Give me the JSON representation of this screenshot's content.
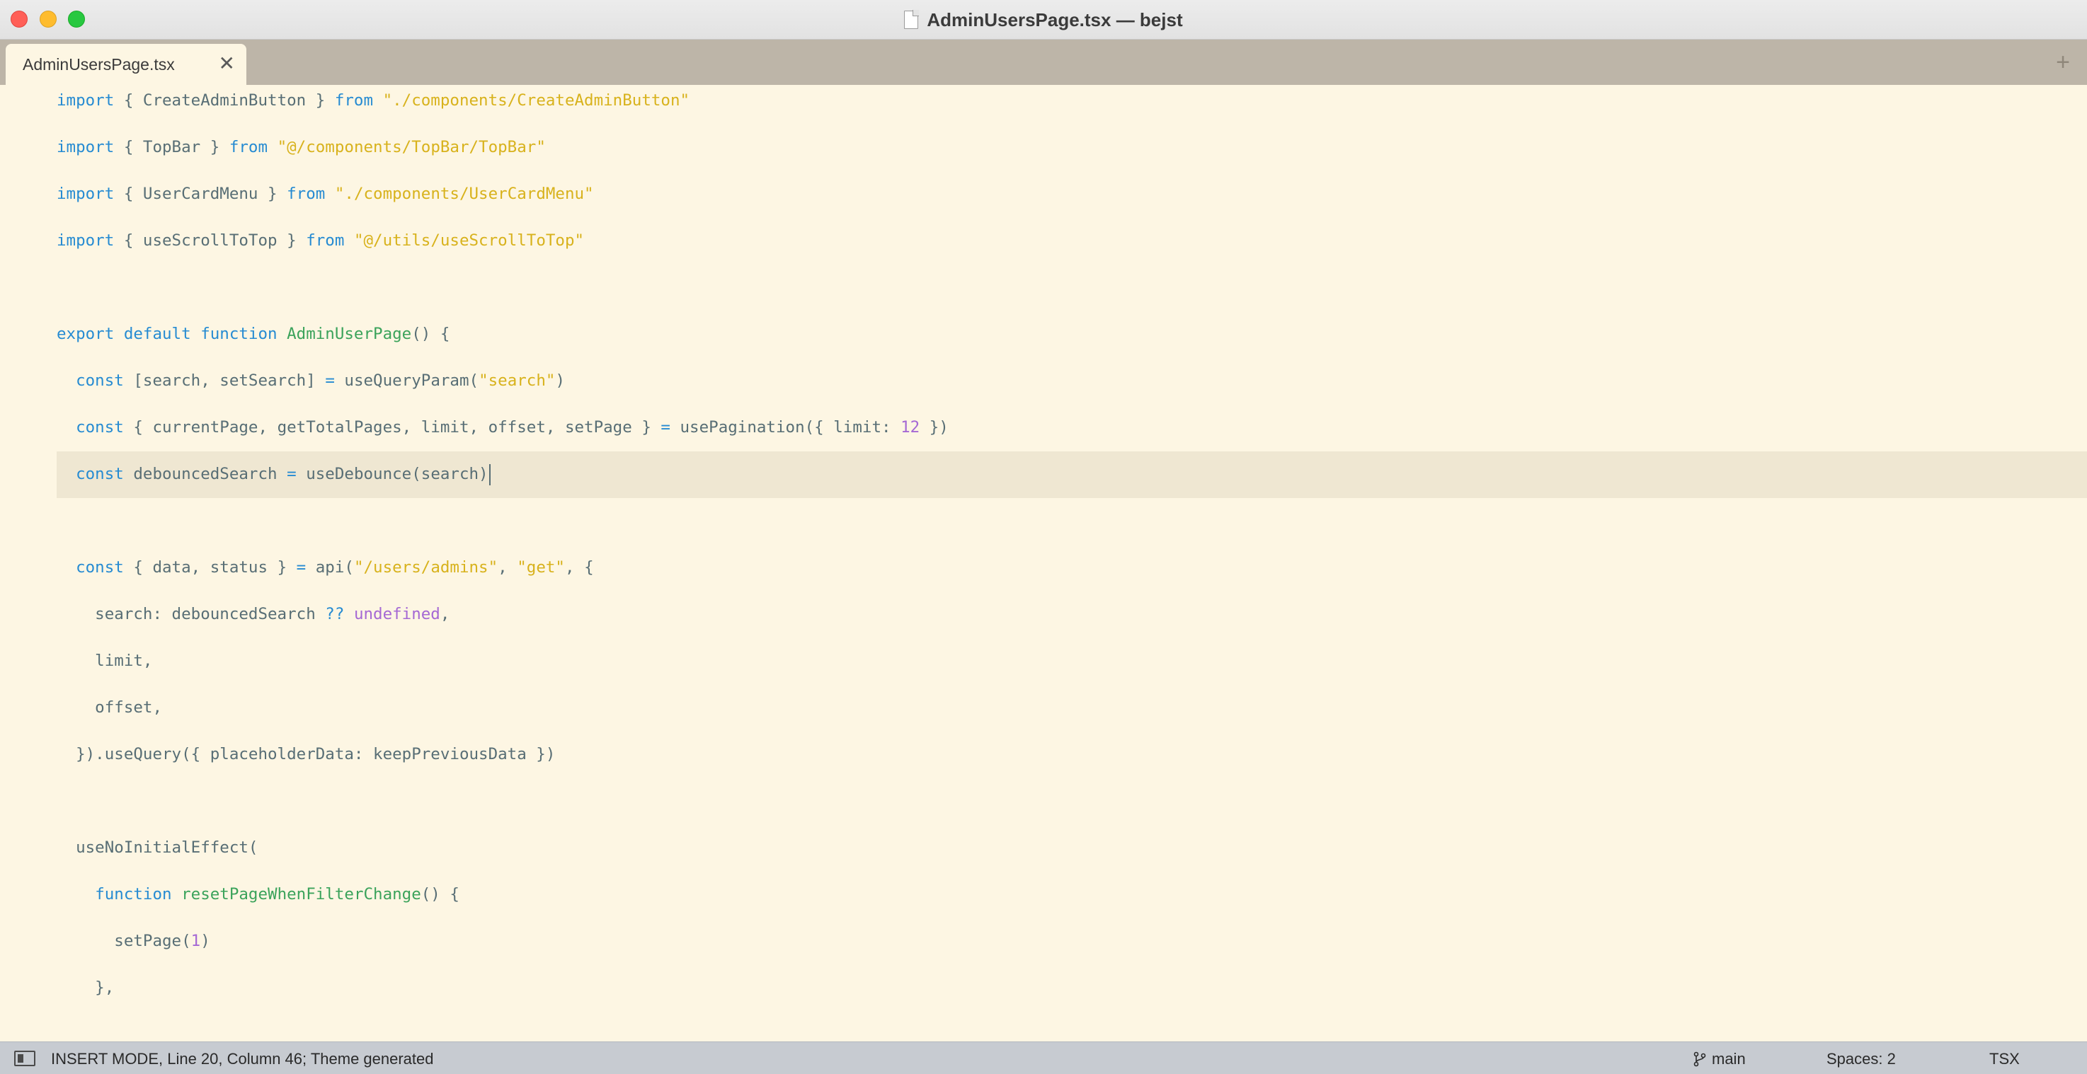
{
  "window": {
    "title": "AdminUsersPage.tsx — bejst"
  },
  "tabs": [
    {
      "label": "AdminUsersPage.tsx",
      "close": "✕"
    }
  ],
  "tabbar": {
    "add_icon": "+"
  },
  "code": [
    [
      [
        "kw",
        "import"
      ],
      [
        "",
        "{ CreateAdminButton } "
      ],
      [
        "kw",
        "from"
      ],
      [
        "",
        ""
      ],
      [
        "str",
        "\"./components/CreateAdminButton\""
      ]
    ],
    [
      [
        "kw",
        "import"
      ],
      [
        "",
        "{ TopBar } "
      ],
      [
        "kw",
        "from"
      ],
      [
        "",
        ""
      ],
      [
        "str",
        "\"@/components/TopBar/TopBar\""
      ]
    ],
    [
      [
        "kw",
        "import"
      ],
      [
        "",
        "{ UserCardMenu } "
      ],
      [
        "kw",
        "from"
      ],
      [
        "",
        ""
      ],
      [
        "str",
        "\"./components/UserCardMenu\""
      ]
    ],
    [
      [
        "kw",
        "import"
      ],
      [
        "",
        "{ useScrollToTop } "
      ],
      [
        "kw",
        "from"
      ],
      [
        "",
        ""
      ],
      [
        "str",
        "\"@/utils/useScrollToTop\""
      ]
    ],
    [],
    [
      [
        "kw",
        "export default function"
      ],
      [
        "fn",
        "AdminUserPage"
      ],
      [
        "",
        "() {"
      ]
    ],
    [
      [
        "",
        "  "
      ],
      [
        "kw",
        "const"
      ],
      [
        "",
        "[search, setSearch] "
      ],
      [
        "kw",
        "="
      ],
      [
        "",
        "useQueryParam("
      ],
      [
        "str",
        "\"search\""
      ],
      [
        "",
        ")"
      ]
    ],
    [
      [
        "",
        "  "
      ],
      [
        "kw",
        "const"
      ],
      [
        "",
        "{ currentPage, getTotalPages, limit, offset, setPage } "
      ],
      [
        "kw",
        "="
      ],
      [
        "",
        "usePagination({ limit: "
      ],
      [
        "num",
        "12"
      ],
      [
        "",
        " })"
      ]
    ],
    [
      [
        "",
        "  "
      ],
      [
        "kw",
        "const"
      ],
      [
        "",
        "debouncedSearch "
      ],
      [
        "kw",
        "="
      ],
      [
        "",
        "useDebounce(search)"
      ]
    ],
    [],
    [
      [
        "",
        "  "
      ],
      [
        "kw",
        "const"
      ],
      [
        "",
        "{ data, status } "
      ],
      [
        "kw",
        "="
      ],
      [
        "",
        "api("
      ],
      [
        "str",
        "\"/users/admins\""
      ],
      [
        "",
        ", "
      ],
      [
        "str",
        "\"get\""
      ],
      [
        "",
        ", {"
      ]
    ],
    [
      [
        "",
        "    search: debouncedSearch "
      ],
      [
        "kw",
        "??"
      ],
      [
        "und",
        "undefined"
      ],
      [
        "",
        ","
      ]
    ],
    [
      [
        "",
        "    limit,"
      ]
    ],
    [
      [
        "",
        "    offset,"
      ]
    ],
    [
      [
        "",
        "  }).useQuery({ placeholderData: keepPreviousData })"
      ]
    ],
    [],
    [
      [
        "",
        "  useNoInitialEffect("
      ]
    ],
    [
      [
        "",
        "    "
      ],
      [
        "kw",
        "function"
      ],
      [
        "fn",
        "resetPageWhenFilterChange"
      ],
      [
        "",
        "() {"
      ]
    ],
    [
      [
        "",
        "      setPage("
      ],
      [
        "num",
        "1"
      ],
      [
        "",
        ")"
      ]
    ],
    [
      [
        "",
        "    },"
      ]
    ]
  ],
  "highlighted_line_index": 8,
  "statusbar": {
    "mode": "INSERT MODE, Line 20, Column 46; Theme generated",
    "branch": "main",
    "spaces": "Spaces: 2",
    "syntax": "TSX"
  },
  "colors": {
    "background": "#fdf6e3",
    "keyword": "#268bd2",
    "string": "#d8b21c",
    "function": "#3ba35b",
    "number": "#a568d4",
    "text": "#586e75"
  }
}
